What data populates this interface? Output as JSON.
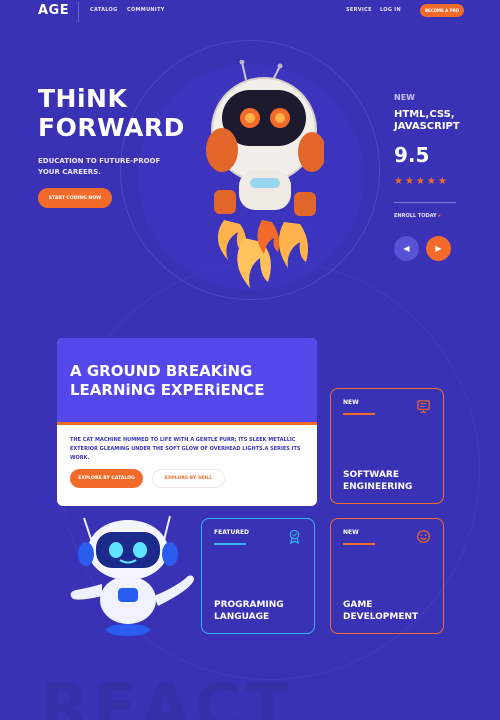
{
  "nav": {
    "logo": "AGE",
    "links": [
      "CATALOG",
      "COMMUNITY",
      "SERVICE",
      "LOG IN"
    ],
    "pro_button": "BECOME A PRO"
  },
  "hero": {
    "title_line1": "THiNK",
    "title_line2": "FORWARD",
    "subtitle": "EDUCATION TO FUTURE-PROOF YOUR CAREERS.",
    "cta": "START CODING NOW"
  },
  "featured_course": {
    "tag": "NEW",
    "name": "HTML,CSS, JAVASCRIPT",
    "rating": "9.5",
    "stars": "★★★★★",
    "enroll": "ENROLL TODAY",
    "prev_icon": "arrow-left-icon",
    "next_icon": "arrow-right-icon"
  },
  "feature_card": {
    "title": "A GROUND BREAKiNG LEARNiNG EXPERiENCE",
    "body": "THE CAT MACHINE HUMMED TO LIFE WITH A GENTLE PURR; ITS SLEEK METALLIC EXTERIOR GLEAMING UNDER THE SOFT GLOW OF OVERHEAD LIGHTS.A SERIES ITS WORK.",
    "btn_catalog": "EXPLORE BY CATALOG",
    "btn_skill": "EXPLORE BY SKILL"
  },
  "course_cards": [
    {
      "tag": "NEW",
      "title": "SOFTWARE ENGINEERING",
      "icon": "monitor-icon"
    },
    {
      "tag": "FEATURED",
      "title": "PROGRAMING LANGUAGE",
      "icon": "badge-icon"
    },
    {
      "tag": "NEW",
      "title": "GAME DEVELOPMENT",
      "icon": "smiley-icon"
    }
  ],
  "watermark": "REACT",
  "colors": {
    "background": "#3a32b4",
    "accent": "#f26b2a",
    "card_purple": "#5548ea",
    "featured_border": "#35b4f2"
  }
}
